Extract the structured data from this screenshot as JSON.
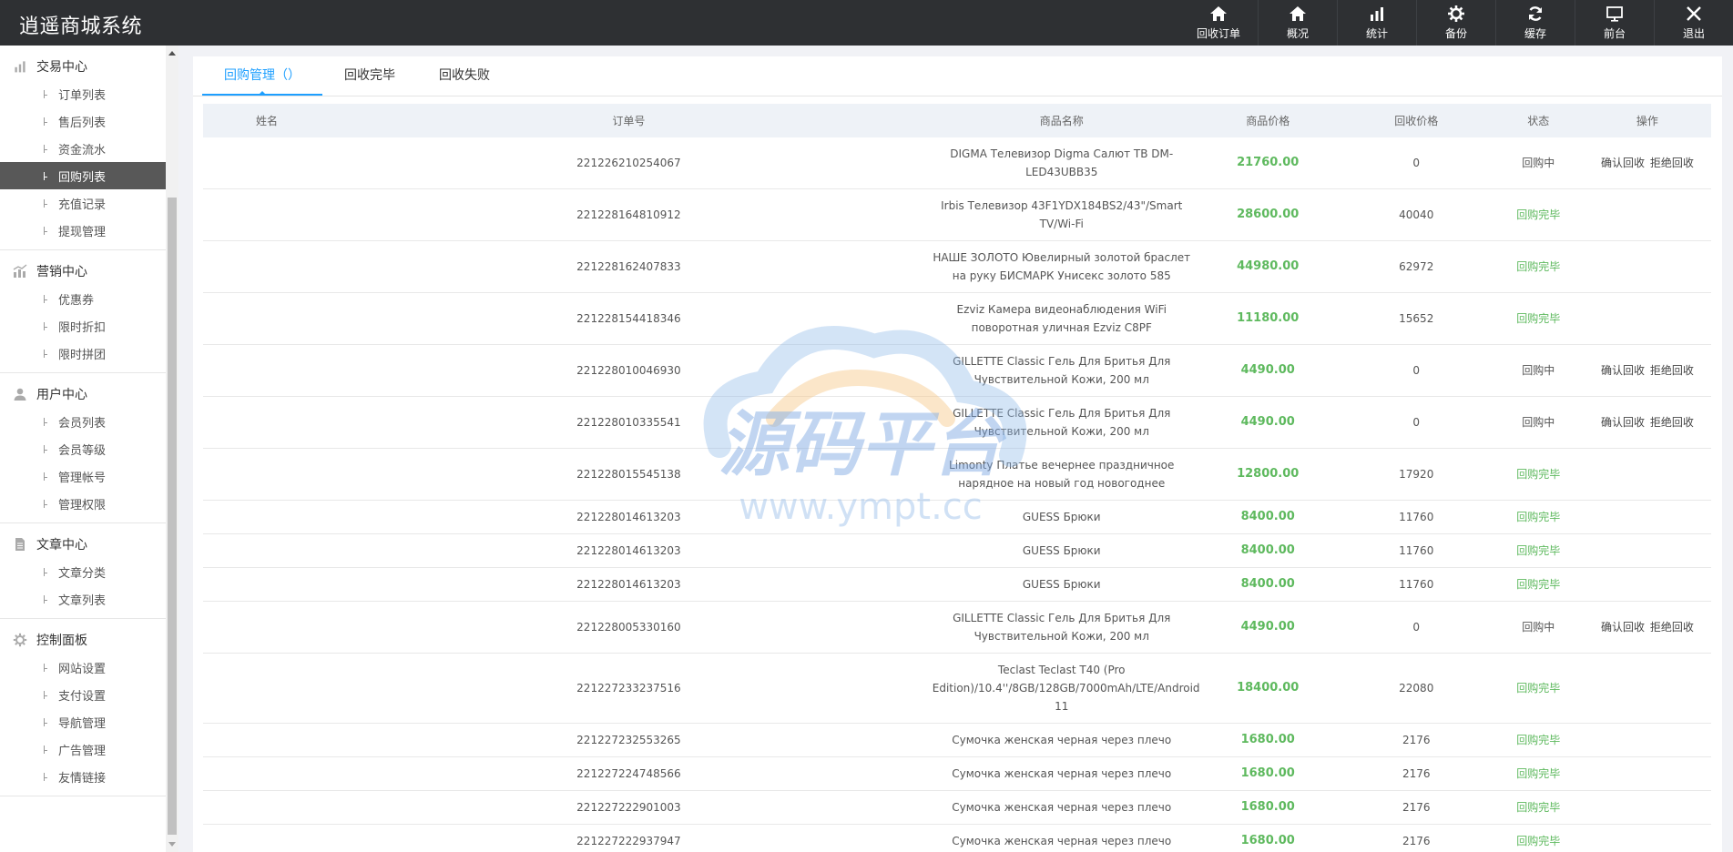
{
  "app": {
    "title": "逍遥商城系统"
  },
  "topnav": [
    {
      "label": "回收订单",
      "icon": "home-icon"
    },
    {
      "label": "概况",
      "icon": "home-icon"
    },
    {
      "label": "统计",
      "icon": "bar-chart-icon"
    },
    {
      "label": "备份",
      "icon": "gear-icon"
    },
    {
      "label": "缓存",
      "icon": "refresh-icon"
    },
    {
      "label": "前台",
      "icon": "monitor-icon"
    },
    {
      "label": "退出",
      "icon": "close-icon"
    }
  ],
  "sidebar": {
    "groups": [
      {
        "title": "交易中心",
        "icon": "bar-chart-icon",
        "items": [
          "订单列表",
          "售后列表",
          "资金流水",
          "回购列表",
          "充值记录",
          "提现管理"
        ]
      },
      {
        "title": "营销中心",
        "icon": "chart-icon",
        "items": [
          "优惠券",
          "限时折扣",
          "限时拼团"
        ]
      },
      {
        "title": "用户中心",
        "icon": "user-icon",
        "items": [
          "会员列表",
          "会员等级",
          "管理帐号",
          "管理权限"
        ]
      },
      {
        "title": "文章中心",
        "icon": "document-icon",
        "items": [
          "文章分类",
          "文章列表"
        ]
      },
      {
        "title": "控制面板",
        "icon": "gear-icon",
        "items": [
          "网站设置",
          "支付设置",
          "导航管理",
          "广告管理",
          "友情链接"
        ]
      }
    ],
    "active": "回购列表"
  },
  "tabs": [
    "回购管理（）",
    "回收完毕",
    "回收失败"
  ],
  "table": {
    "headers": [
      "姓名",
      "订单号",
      "商品名称",
      "商品价格",
      "回收价格",
      "状态",
      "操作"
    ],
    "actions": {
      "confirm": "确认回收",
      "reject": "拒绝回收"
    },
    "rows": [
      {
        "name": "",
        "order": "221226210254067",
        "product": "DIGMA Телевизор Digma Салют ТВ DM-LED43UBB35",
        "price": "21760.00",
        "recycle": "0",
        "status": "回购中",
        "pending": true
      },
      {
        "name": "",
        "order": "221228164810912",
        "product": "Irbis Телевизор 43F1YDX184BS2/43\"/Smart TV/Wi-Fi",
        "price": "28600.00",
        "recycle": "40040",
        "status": "回购完毕",
        "pending": false
      },
      {
        "name": "",
        "order": "221228162407833",
        "product": "НАШЕ ЗОЛОТО Ювелирный золотой браслет на руку БИСМАРК Унисекс золото 585",
        "price": "44980.00",
        "recycle": "62972",
        "status": "回购完毕",
        "pending": false
      },
      {
        "name": "",
        "order": "221228154418346",
        "product": "Ezviz Камера видеонаблюдения WiFi поворотная уличная Ezviz C8PF",
        "price": "11180.00",
        "recycle": "15652",
        "status": "回购完毕",
        "pending": false
      },
      {
        "name": "",
        "order": "221228010046930",
        "product": "GILLETTE Classic Гель Для Бритья Для Чувствительной Кожи, 200 мл",
        "price": "4490.00",
        "recycle": "0",
        "status": "回购中",
        "pending": true
      },
      {
        "name": "",
        "order": "221228010335541",
        "product": "GILLETTE Classic Гель Для Бритья Для Чувствительной Кожи, 200 мл",
        "price": "4490.00",
        "recycle": "0",
        "status": "回购中",
        "pending": true
      },
      {
        "name": "",
        "order": "221228015545138",
        "product": "Limonty Платье вечернее праздничное нарядное на новый год новогоднее",
        "price": "12800.00",
        "recycle": "17920",
        "status": "回购完毕",
        "pending": false
      },
      {
        "name": "",
        "order": "221228014613203",
        "product": "GUESS Брюки",
        "price": "8400.00",
        "recycle": "11760",
        "status": "回购完毕",
        "pending": false
      },
      {
        "name": "",
        "order": "221228014613203",
        "product": "GUESS Брюки",
        "price": "8400.00",
        "recycle": "11760",
        "status": "回购完毕",
        "pending": false
      },
      {
        "name": "",
        "order": "221228014613203",
        "product": "GUESS Брюки",
        "price": "8400.00",
        "recycle": "11760",
        "status": "回购完毕",
        "pending": false
      },
      {
        "name": "",
        "order": "221228005330160",
        "product": "GILLETTE Classic Гель Для Бритья Для Чувствительной Кожи, 200 мл",
        "price": "4490.00",
        "recycle": "0",
        "status": "回购中",
        "pending": true
      },
      {
        "name": "",
        "order": "221227233237516",
        "product": "Teclast Teclast T40 (Pro Edition)/10.4''/8GB/128GB/7000mAh/LTE/Android 11",
        "price": "18400.00",
        "recycle": "22080",
        "status": "回购完毕",
        "pending": false
      },
      {
        "name": "",
        "order": "221227232553265",
        "product": "Сумочка женская черная через плечо",
        "price": "1680.00",
        "recycle": "2176",
        "status": "回购完毕",
        "pending": false
      },
      {
        "name": "",
        "order": "221227224748566",
        "product": "Сумочка женская черная через плечо",
        "price": "1680.00",
        "recycle": "2176",
        "status": "回购完毕",
        "pending": false
      },
      {
        "name": "",
        "order": "221227222901003",
        "product": "Сумочка женская черная через плечо",
        "price": "1680.00",
        "recycle": "2176",
        "status": "回购完毕",
        "pending": false
      },
      {
        "name": "",
        "order": "221227222937947",
        "product": "Сумочка женская черная через плечо",
        "price": "1680.00",
        "recycle": "2176",
        "status": "回购完毕",
        "pending": false
      }
    ]
  },
  "watermark": {
    "text": "源码平台",
    "url": "www.ympt.cc"
  },
  "colors": {
    "topbar": "#2e3033",
    "accent": "#1e9fff",
    "price": "#5eb95e",
    "active_sidebar": "#585858"
  }
}
